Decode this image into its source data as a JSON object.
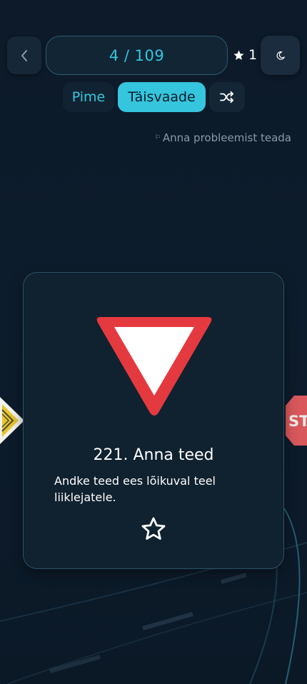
{
  "header": {
    "counter": "4 / 109",
    "favorites_count": "1"
  },
  "mode_switch": {
    "blind_label": "Pime",
    "full_label": "Täisvaade",
    "active": "full"
  },
  "report_label": "Anna probleemist teada",
  "card": {
    "title": "221. Anna teed",
    "description": "Andke teed ees lõikuval teel liiklejatele."
  },
  "side_cards": {
    "right_partial_text": "ST"
  },
  "colors": {
    "accent": "#35c5dd",
    "background": "#0c1a29",
    "card_background": "#10212f",
    "card_border": "#2c5366",
    "sign_red": "#e43a3f"
  },
  "icons": {
    "back": "chevron-left-icon",
    "favorites": "star-filled-icon",
    "theme": "moon-icon",
    "shuffle": "shuffle-icon",
    "report": "flag-icon",
    "card_favorite": "star-outline-icon"
  }
}
